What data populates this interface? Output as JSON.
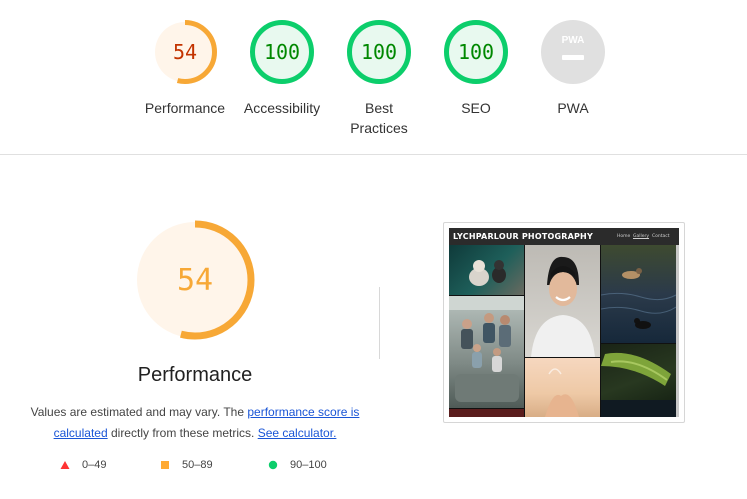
{
  "summary": [
    {
      "id": "performance",
      "score": "54",
      "label_lines": [
        "Performance"
      ],
      "color": "#f7a836",
      "fill": "#fff5ea",
      "text_color": "#c33300",
      "fraction": 0.54
    },
    {
      "id": "accessibility",
      "score": "100",
      "label_lines": [
        "Accessibility"
      ],
      "color": "#0cce6b",
      "fill": "#e8f9ef",
      "text_color": "#008800",
      "fraction": 1.0
    },
    {
      "id": "best-practices",
      "score": "100",
      "label_lines": [
        "Best",
        "Practices"
      ],
      "color": "#0cce6b",
      "fill": "#e8f9ef",
      "text_color": "#008800",
      "fraction": 1.0
    },
    {
      "id": "seo",
      "score": "100",
      "label_lines": [
        "SEO"
      ],
      "color": "#0cce6b",
      "fill": "#e8f9ef",
      "text_color": "#008800",
      "fraction": 1.0
    },
    {
      "id": "pwa",
      "badge": "PWA",
      "label_lines": [
        "PWA"
      ],
      "fill": "#e0e0e0"
    }
  ],
  "performance": {
    "score": "54",
    "fraction": 0.54,
    "title": "Performance",
    "color": "#f7a836",
    "fill": "#fff5ea",
    "desc_1": "Values are estimated and may vary. The ",
    "link_score": "performance score is calculated",
    "desc_2": " directly from these metrics. ",
    "link_calc": "See calculator."
  },
  "legend": [
    {
      "range": "0–49",
      "shape": "triangle",
      "color": "#ff3333"
    },
    {
      "range": "50–89",
      "shape": "square",
      "color": "#ffaa33"
    },
    {
      "range": "90–100",
      "shape": "circle",
      "color": "#0cce6b"
    }
  ],
  "screenshot": {
    "brand": "LYCHPARLOUR PHOTOGRAPHY",
    "nav": [
      "Home",
      "Gallery",
      "Contact"
    ]
  }
}
